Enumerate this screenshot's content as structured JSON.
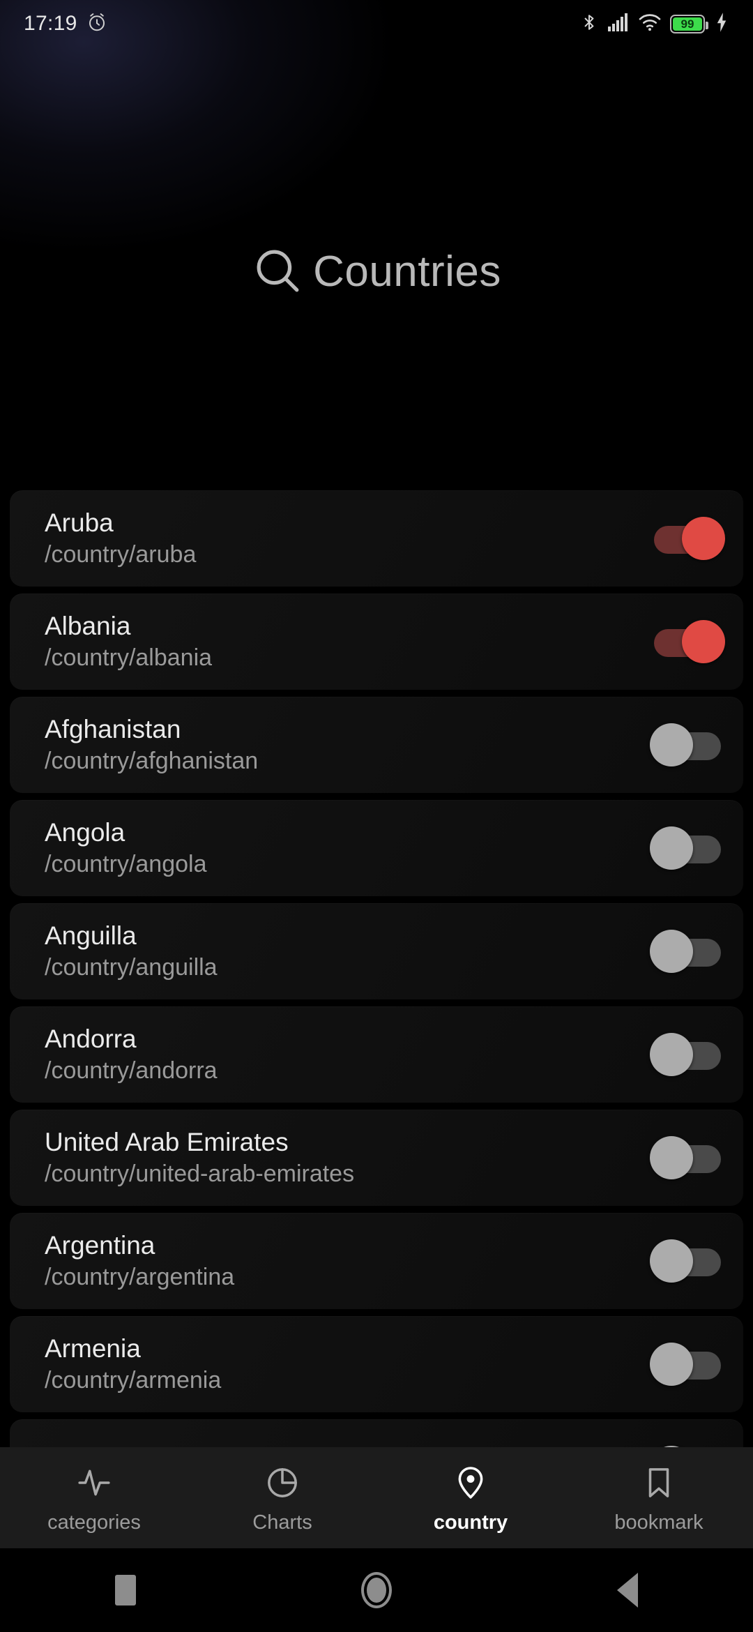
{
  "statusbar": {
    "time": "17:19",
    "alarm_icon": "alarm-clock-icon",
    "bluetooth_icon": "bluetooth-icon",
    "signal_icon": "cellular-signal-icon",
    "wifi_icon": "wifi-icon",
    "battery_level": "99",
    "charging_icon": "charging-bolt-icon"
  },
  "header": {
    "search_icon": "search-icon",
    "title": "Countries"
  },
  "colors": {
    "accent_on": "#e04a44",
    "track_on": "#6e3130",
    "thumb_off": "#acacac",
    "track_off": "#4a4a4a",
    "card_bg": "#111111",
    "page_bg": "#000000",
    "nav_bg": "#1c1c1c",
    "battery_green": "#3ddc4b"
  },
  "list": {
    "items": [
      {
        "name": "Aruba",
        "path": "/country/aruba",
        "enabled": true
      },
      {
        "name": "Albania",
        "path": "/country/albania",
        "enabled": true
      },
      {
        "name": "Afghanistan",
        "path": "/country/afghanistan",
        "enabled": false
      },
      {
        "name": "Angola",
        "path": "/country/angola",
        "enabled": false
      },
      {
        "name": "Anguilla",
        "path": "/country/anguilla",
        "enabled": false
      },
      {
        "name": "Andorra",
        "path": "/country/andorra",
        "enabled": false
      },
      {
        "name": "United Arab Emirates",
        "path": "/country/united-arab-emirates",
        "enabled": false
      },
      {
        "name": "Argentina",
        "path": "/country/argentina",
        "enabled": false
      },
      {
        "name": "Armenia",
        "path": "/country/armenia",
        "enabled": false
      },
      {
        "name": "",
        "path": "",
        "enabled": false
      }
    ]
  },
  "bottomnav": {
    "items": [
      {
        "label": "categories",
        "icon": "activity-pulse-icon",
        "active": false
      },
      {
        "label": "Charts",
        "icon": "pie-chart-icon",
        "active": false
      },
      {
        "label": "country",
        "icon": "map-pin-icon",
        "active": true
      },
      {
        "label": "bookmark",
        "icon": "bookmark-icon",
        "active": false
      }
    ]
  },
  "androidnav": {
    "recents": "recents-square-icon",
    "home": "home-circle-icon",
    "back": "back-triangle-icon"
  }
}
